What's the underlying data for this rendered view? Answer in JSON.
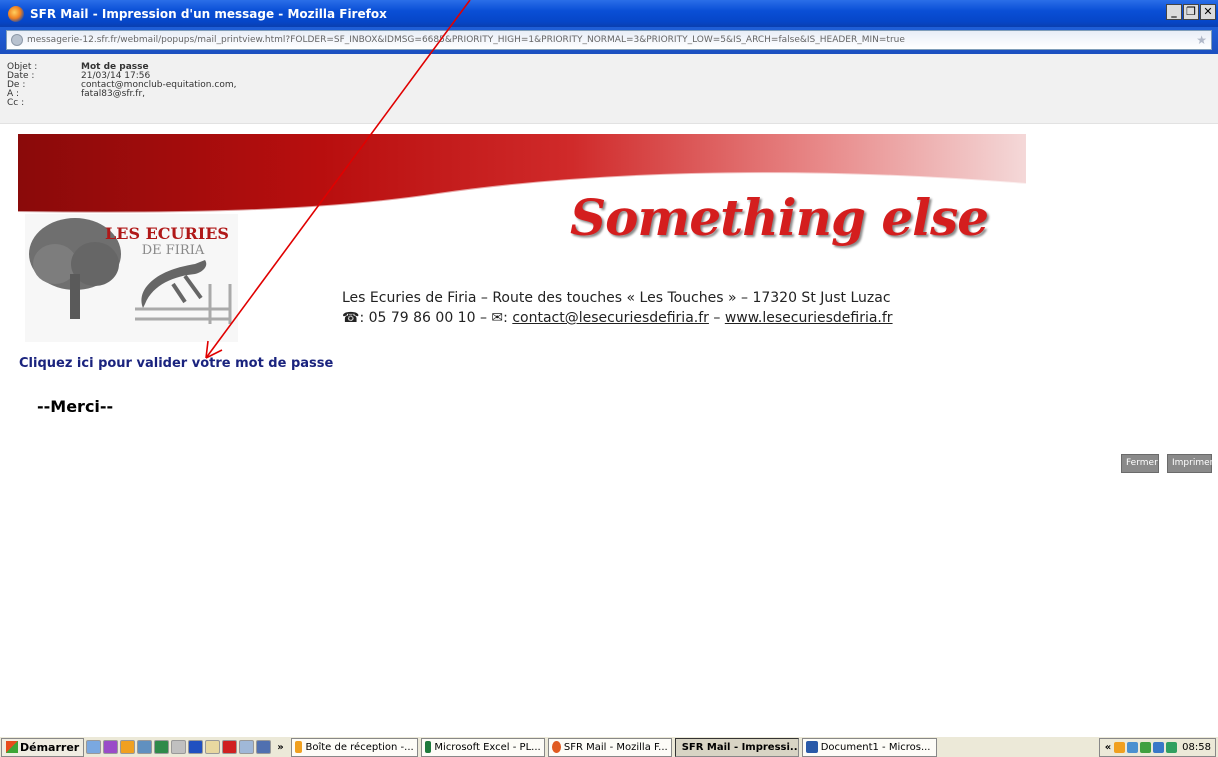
{
  "window": {
    "title": "SFR Mail - Impression d'un message - Mozilla Firefox",
    "controls": [
      "_",
      "❐",
      "✕"
    ]
  },
  "urlbar": {
    "url": "messagerie-12.sfr.fr/webmail/popups/mail_printview.html?FOLDER=SF_INBOX&IDMSG=6685&PRIORITY_HIGH=1&PRIORITY_NORMAL=3&PRIORITY_LOW=5&IS_ARCH=false&IS_HEADER_MIN=true"
  },
  "header": {
    "subject_label": "Objet :",
    "subject": "Mot de passe",
    "date_label": "Date :",
    "date": "21/03/14 17:56",
    "from_label": "De :",
    "from": "contact@monclub-equitation.com,",
    "to_label": "A :",
    "to": "fatal83@sfr.fr,",
    "cc_label": "Cc :",
    "cc": ""
  },
  "email": {
    "logo_line1": "LES ECURIES",
    "logo_line2": "DE FIRIA",
    "slogan": "Something else",
    "address_line": "Les Ecuries de Firia – Route des touches « Les Touches » – 17320 St Just Luzac",
    "phone_icon": "☎",
    "phone": ": 05 79 86 00 10 – ",
    "mail_icon": "✉",
    "mail_sep": ": ",
    "email_link": "contact@lesecuriesdefiria.fr",
    "dash": " – ",
    "web_link": "www.lesecuriesdefiria.fr",
    "validate_link": "Cliquez ici pour valider votre mot de passe",
    "merci": "--Merci--"
  },
  "buttons": {
    "close": "Fermer",
    "print": "Imprimer"
  },
  "taskbar": {
    "start": "Démarrer",
    "more": "»",
    "tasks": [
      {
        "label": "Boîte de réception -...",
        "icon_color": "#f0a020"
      },
      {
        "label": "Microsoft Excel - PL...",
        "icon_color": "#1e7a3c"
      },
      {
        "label": "SFR Mail - Mozilla F...",
        "icon_color": "#e05a20"
      },
      {
        "label": "SFR Mail - Impressi...",
        "icon_color": "#e05a20",
        "active": true
      },
      {
        "label": "Document1 - Micros...",
        "icon_color": "#2a5aa8"
      }
    ],
    "tray_expand": "«",
    "clock": "08:58"
  },
  "colors": {
    "accent_red": "#d41e1e",
    "link_blue": "#1a237e",
    "title_blue": "#0a4fd6"
  }
}
